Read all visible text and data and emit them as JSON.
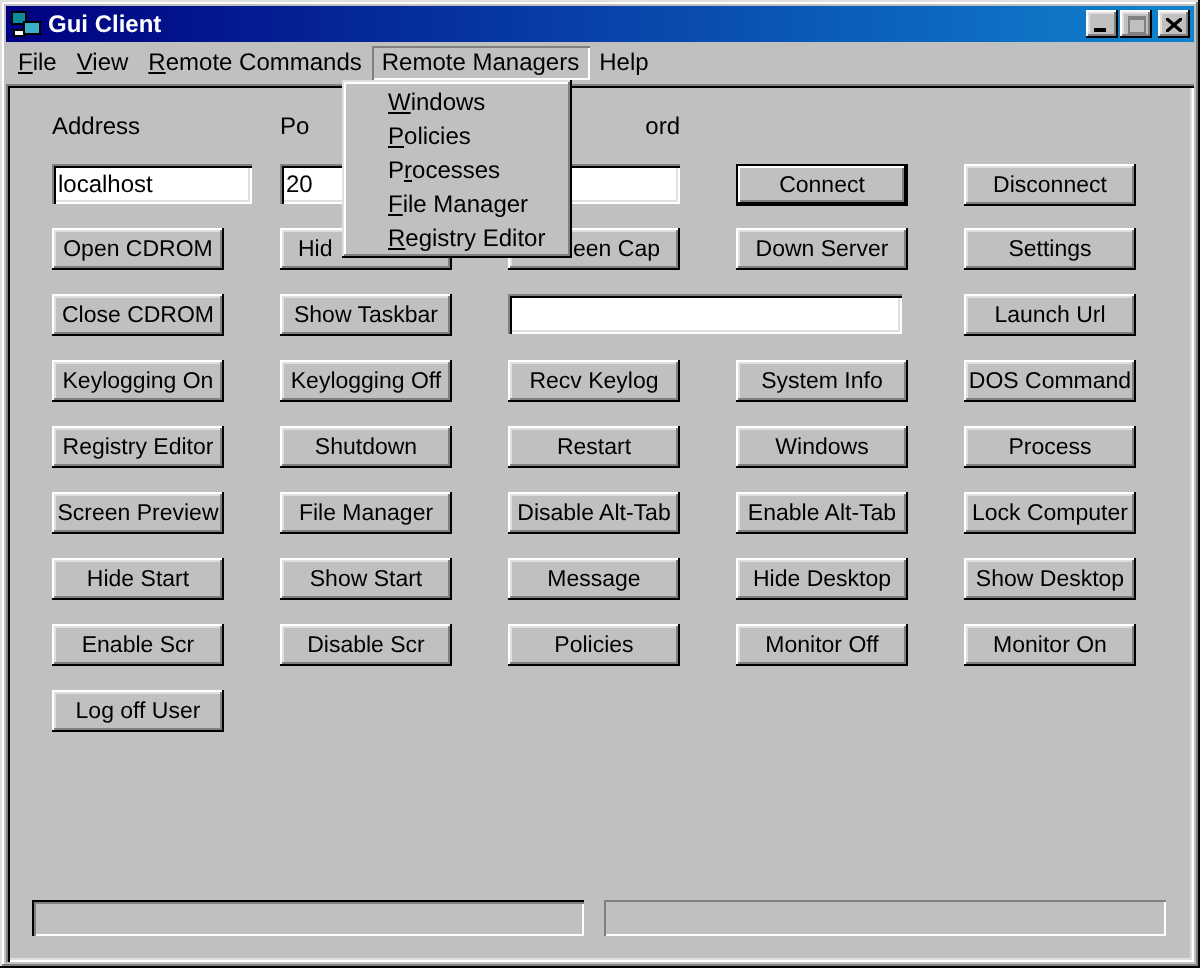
{
  "window": {
    "title": "Gui Client"
  },
  "menu_bar": [
    {
      "underlined": "F",
      "after": "ile",
      "selected": false
    },
    {
      "underlined": "V",
      "after": "iew",
      "selected": false
    },
    {
      "underlined": "R",
      "after": "emote Commands",
      "selected": false
    },
    {
      "before": "Remote Managers",
      "selected": true
    },
    {
      "before": "Help",
      "selected": false
    }
  ],
  "open_menu": {
    "items": [
      {
        "underlined": "W",
        "after": "indows"
      },
      {
        "underlined": "P",
        "after": "olicies"
      },
      {
        "before": "P",
        "underlined": "r",
        "after": "ocesses"
      },
      {
        "underlined": "F",
        "after": "ile Manager"
      },
      {
        "underlined": "R",
        "after": "egistry Editor"
      }
    ]
  },
  "connection": {
    "address_label": "Address",
    "address_value": "localhost",
    "port_label": "Po",
    "port_value": "20",
    "password_label": "ord",
    "buttons": [
      {
        "label": "Connect",
        "default": true
      },
      {
        "label": "Disconnect",
        "default": false
      }
    ]
  },
  "grid": [
    [
      {
        "kind": "button",
        "label": "Open CDROM"
      },
      {
        "kind": "button_cut_right",
        "label": "Hid"
      },
      {
        "kind": "button_cut_left",
        "label": "een Cap"
      },
      {
        "kind": "button",
        "label": "Down Server"
      },
      {
        "kind": "button",
        "label": "Settings"
      }
    ],
    [
      {
        "kind": "button",
        "label": "Close CDROM"
      },
      {
        "kind": "button",
        "label": "Show Taskbar"
      },
      {
        "kind": "wide_field"
      },
      {
        "kind": "button",
        "label": "Launch Url"
      }
    ],
    [
      {
        "kind": "button",
        "label": "Keylogging On"
      },
      {
        "kind": "button",
        "label": "Keylogging Off"
      },
      {
        "kind": "button",
        "label": "Recv Keylog"
      },
      {
        "kind": "button",
        "label": "System Info"
      },
      {
        "kind": "button",
        "label": "DOS Command"
      }
    ],
    [
      {
        "kind": "button",
        "label": "Registry Editor"
      },
      {
        "kind": "button",
        "label": "Shutdown"
      },
      {
        "kind": "button",
        "label": "Restart"
      },
      {
        "kind": "button",
        "label": "Windows"
      },
      {
        "kind": "button",
        "label": "Process"
      }
    ],
    [
      {
        "kind": "button",
        "label": "Screen Preview"
      },
      {
        "kind": "button",
        "label": "File Manager"
      },
      {
        "kind": "button",
        "label": "Disable Alt-Tab"
      },
      {
        "kind": "button",
        "label": "Enable Alt-Tab"
      },
      {
        "kind": "button",
        "label": "Lock Computer"
      }
    ],
    [
      {
        "kind": "button",
        "label": "Hide Start"
      },
      {
        "kind": "button",
        "label": "Show Start"
      },
      {
        "kind": "button",
        "label": "Message"
      },
      {
        "kind": "button",
        "label": "Hide Desktop"
      },
      {
        "kind": "button",
        "label": "Show Desktop"
      }
    ],
    [
      {
        "kind": "button",
        "label": "Enable Scr"
      },
      {
        "kind": "button",
        "label": "Disable Scr"
      },
      {
        "kind": "button",
        "label": "Policies"
      },
      {
        "kind": "button",
        "label": "Monitor Off"
      },
      {
        "kind": "button",
        "label": "Monitor On"
      }
    ],
    [
      {
        "kind": "button",
        "label": "Log off User"
      }
    ]
  ],
  "status_bar": {
    "panels": [
      {
        "kind": "panel"
      },
      {
        "kind": "panel"
      }
    ]
  }
}
